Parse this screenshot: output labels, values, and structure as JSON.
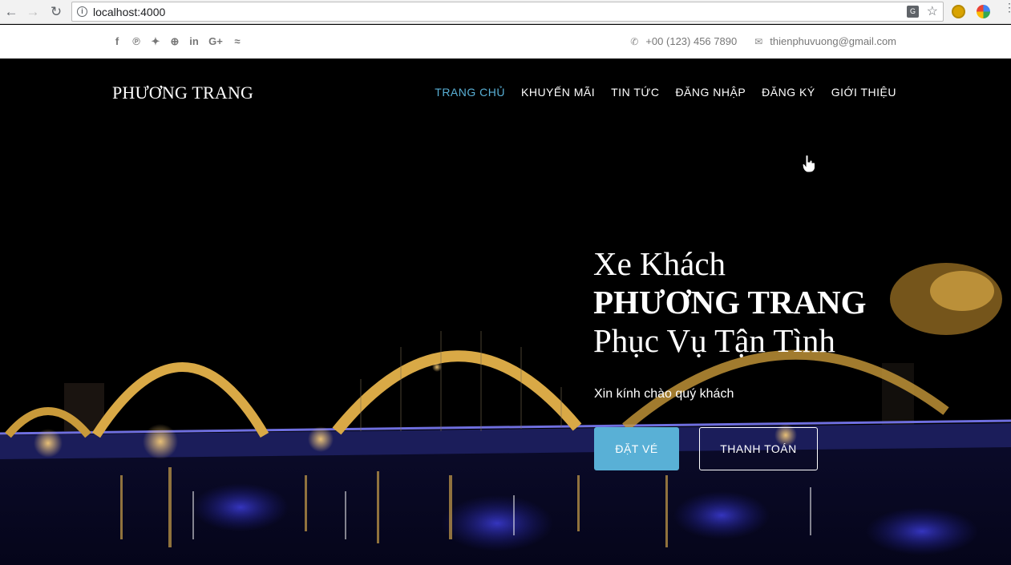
{
  "browser": {
    "url": "localhost:4000"
  },
  "topbar": {
    "social_icons": [
      "facebook-icon",
      "pinterest-icon",
      "twitter-icon",
      "dribbble-icon",
      "linkedin-icon",
      "google-plus-icon",
      "rss-icon"
    ],
    "phone": "+00 (123) 456 7890",
    "email": "thienphuvuong@gmail.com"
  },
  "navbar": {
    "brand": "PHƯƠNG TRANG",
    "items": [
      {
        "label": "TRANG CHỦ",
        "active": true
      },
      {
        "label": "KHUYẾN MÃI",
        "active": false
      },
      {
        "label": "TIN TỨC",
        "active": false
      },
      {
        "label": "ĐĂNG NHẬP",
        "active": false
      },
      {
        "label": "ĐĂNG KÝ",
        "active": false
      },
      {
        "label": "GIỚI THIỆU",
        "active": false
      }
    ]
  },
  "hero": {
    "line1": "Xe Khách",
    "line2": "PHƯƠNG TRANG",
    "line3": "Phục Vụ Tận Tình",
    "greeting": "Xin kính chào quý khách",
    "primary_button": "ĐẶT VÉ",
    "secondary_button": "THANH TOÁN"
  },
  "colors": {
    "accent": "#59b0d6",
    "hero_background": "#000000",
    "topbar_text": "#777777"
  }
}
